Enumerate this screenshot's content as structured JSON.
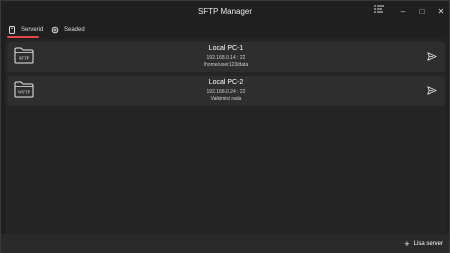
{
  "window": {
    "title": "SFTP Manager",
    "controls": {
      "menu_icon": "list-settings-icon",
      "minimize": "–",
      "maximize": "□",
      "close": "✕"
    }
  },
  "tabs": [
    {
      "label": "Serverid",
      "icon": "device-icon",
      "active": true
    },
    {
      "label": "Seaded",
      "icon": "gear-icon",
      "active": false
    }
  ],
  "servers": [
    {
      "protocol_badge": "SFTP",
      "name": "Local PC-1",
      "address": "192.168.0.14 : 22",
      "path": "/home/user123/data"
    },
    {
      "protocol_badge": "WFTP",
      "name": "Local PC-2",
      "address": "192.168.0.24 : 22",
      "path": "Vaikimisi rada"
    }
  ],
  "footer": {
    "add_label": "Lisa server",
    "add_icon": "plus-icon"
  },
  "colors": {
    "accent": "#e04848",
    "background": "#1f1f1f",
    "card": "#2e2e2e"
  }
}
